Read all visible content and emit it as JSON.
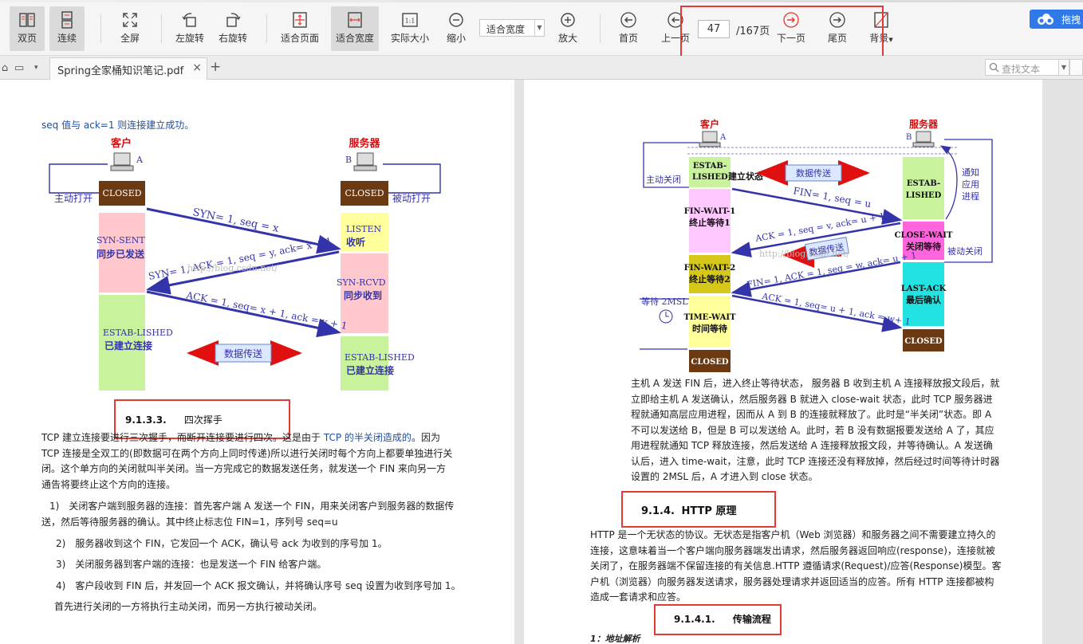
{
  "toolbar": {
    "double_page": "双页",
    "continuous": "连续",
    "fullscreen": "全屏",
    "rotate_left": "左旋转",
    "rotate_right": "右旋转",
    "fit_page": "适合页面",
    "fit_width": "适合宽度",
    "actual_size": "实际大小",
    "actual_size_glyph": "1:1",
    "zoom_out": "缩小",
    "zoom_value": "适合宽度",
    "zoom_in": "放大",
    "first_page": "首页",
    "prev_page": "上一页",
    "current_page": "47",
    "total_pages": "/167页",
    "next_page": "下一页",
    "last_page": "尾页",
    "background": "背景",
    "cloud_button": "拖拽"
  },
  "tabs": {
    "file_name": "Spring全家桶知识笔记.pdf",
    "close": "×",
    "add": "+",
    "search_placeholder": "查找文本"
  },
  "left_page": {
    "top_line": "seq 值与 ack=1 则连接建立成功。",
    "diagram": {
      "client": "客户",
      "server": "服务器",
      "host_a": "A",
      "host_b": "B",
      "closed_left": "CLOSED",
      "closed_right": "CLOSED",
      "active_open": "主动打开",
      "passive_open": "被动打开",
      "syn_sent_en": "SYN-SENT",
      "syn_sent_cn": "同步已发送",
      "listen_en": "LISTEN",
      "listen_cn": "收听",
      "syn_rcvd_en": "SYN-RCVD",
      "syn_rcvd_cn": "同步收到",
      "estab_left_en": "ESTAB-LISHED",
      "estab_left_cn": "已建立连接",
      "estab_right_en": "ESTAB-LISHED",
      "estab_right_cn": "已建立连接",
      "msg1": "SYN= 1, seq = x",
      "msg2": "SYN= 1, ACK = 1, seq = y, ack= x + 1",
      "msg3": "ACK = 1, seq= x + 1, ack = y + 1",
      "data_transfer": "数据传送",
      "watermark": "http://blog.csdn.net/"
    },
    "heading_num": "9.1.3.3.",
    "heading_text": "四次挥手",
    "para1_a": "TCP 建立连接要进行三次握手，而断开连接要进行四次。这是由于 ",
    "para1_link": "TCP 的半关闭造成的",
    "para1_b": "。因为 TCP 连接是全双工的(即数据可在两个方向上同时传递)所以进行关闭时每个方向上都要单独进行关闭。这个单方向的关闭就叫半关闭。当一方完成它的数据发送任务，就发送一个 FIN 来向另一方通告将要终止这个方向的连接。",
    "item1": "1)　关闭客户端到服务器的连接：首先客户端 A 发送一个 FIN，用来关闭客户到服务器的数据传送，然后等待服务器的确认。其中终止标志位 FIN=1，序列号 seq=u",
    "item2": "2)　服务器收到这个 FIN，它发回一个 ACK，确认号 ack 为收到的序号加 1。",
    "item3": "3)　关闭服务器到客户端的连接：也是发送一个 FIN 给客户端。",
    "item4": "4)　客户段收到 FIN 后，并发回一个 ACK 报文确认，并将确认序号 seq 设置为收到序号加 1。",
    "last_line": "首先进行关闭的一方将执行主动关闭，而另一方执行被动关闭。"
  },
  "right_page": {
    "diagram": {
      "client": "客户",
      "server": "服务器",
      "host_a": "A",
      "host_b": "B",
      "active_close": "主动关闭",
      "estab_left_en": "ESTAB-",
      "estab_left_en2": "LISHED",
      "estab_left_cn": "建立状态",
      "fin_wait1_en": "FIN-WAIT-1",
      "fin_wait1_cn": "终止等待1",
      "fin_wait2_en": "FIN-WAIT-2",
      "fin_wait2_cn": "终止等待2",
      "wait_2msl": "等待 2MSL",
      "time_wait_en": "TIME-WAIT",
      "time_wait_cn": "时间等待",
      "closed_left": "CLOSED",
      "estab_right_en": "ESTAB-",
      "estab_right_en2": "LISHED",
      "notify_app1": "通知",
      "notify_app2": "应用",
      "notify_app3": "进程",
      "close_wait_en": "CLOSE-WAIT",
      "close_wait_cn": "关闭等待",
      "passive_close": "被动关闭",
      "last_ack_en": "LAST-ACK",
      "last_ack_cn": "最后确认",
      "closed_right": "CLOSED",
      "data_transfer1": "数据传送",
      "data_transfer2": "数据传送",
      "msg1": "FIN= 1, seq = u",
      "msg2": "ACK = 1, seq = v, ack= u + 1",
      "msg3": "FIN= 1, ACK = 1, seq = w, ack= u + 1",
      "msg4": "ACK = 1, seq= u + 1, ack = w+ 1",
      "watermark": "http://blog.csdn.net/"
    },
    "para1": "主机 A 发送 FIN 后，进入终止等待状态， 服务器 B 收到主机 A 连接释放报文段后，就立即给主机 A 发送确认，然后服务器 B 就进入 close-wait 状态，此时 TCP 服务器进程就通知高层应用进程，因而从 A 到 B 的连接就释放了。此时是“半关闭”状态。即 A 不可以发送给 B，但是 B 可以发送给 A。此时，若 B 没有数据报要发送给 A 了，其应用进程就通知 TCP 释放连接，然后发送给 A 连接释放报文段，并等待确认。A 发送确认后，进入 time-wait，注意，此时 TCP 连接还没有释放掉，然后经过时间等待计时器设置的 2MSL 后，A 才进入到 close 状态。",
    "heading1_num": "9.1.4.",
    "heading1_text": "HTTP 原理",
    "para2": "HTTP 是一个无状态的协议。无状态是指客户机（Web 浏览器）和服务器之间不需要建立持久的连接，这意味着当一个客户端向服务器端发出请求，然后服务器返回响应(response)，连接就被关闭了，在服务器端不保留连接的有关信息.HTTP 遵循请求(Request)/应答(Response)模型。客户机（浏览器）向服务器发送请求，服务器处理请求并返回适当的应答。所有 HTTP 连接都被构造成一套请求和应答。",
    "heading2_num": "9.1.4.1.",
    "heading2_text": "传输流程",
    "sub1": "1：地址解析"
  }
}
